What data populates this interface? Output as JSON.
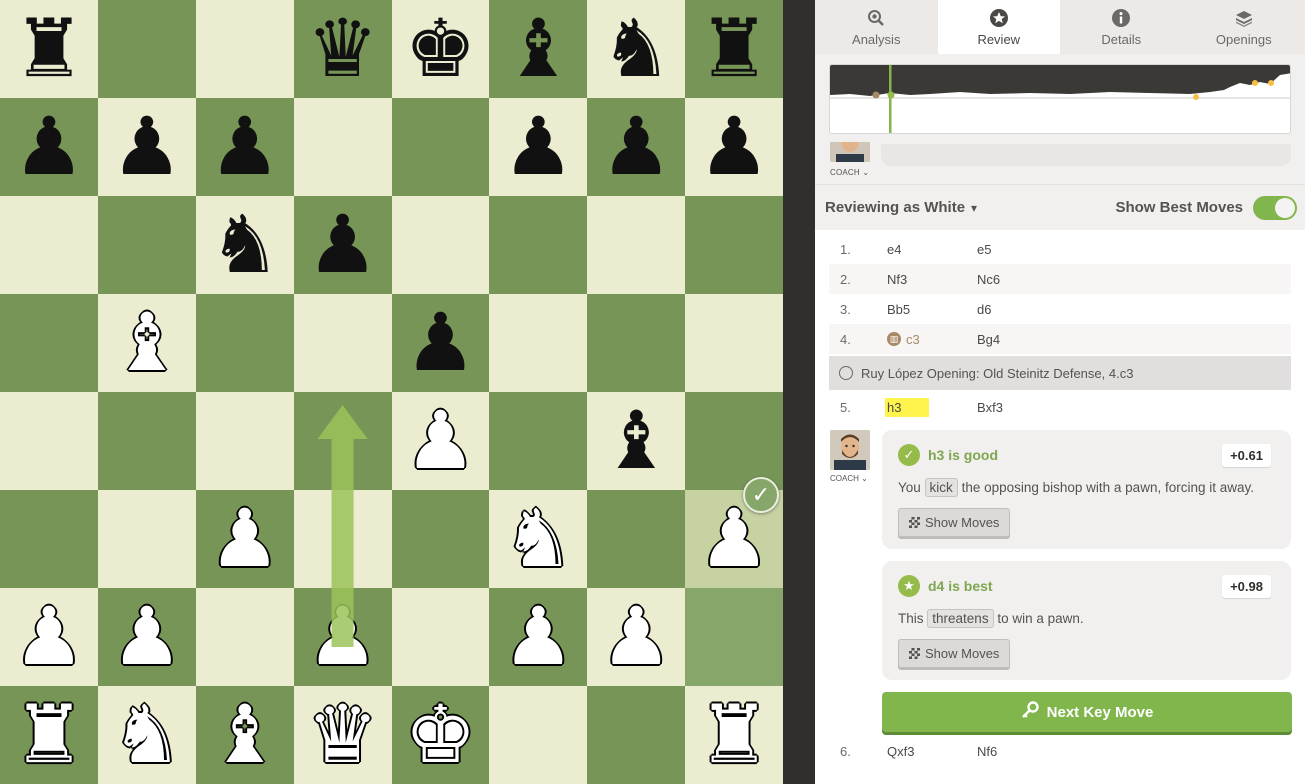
{
  "board": {
    "pieces": [
      [
        "r",
        "",
        "",
        "q",
        "k",
        "b",
        "n",
        "r"
      ],
      [
        "p",
        "p",
        "p",
        "",
        "",
        "p",
        "p",
        "p"
      ],
      [
        "",
        "",
        "n",
        "p",
        "",
        "",
        "",
        ""
      ],
      [
        "",
        "B",
        "",
        "",
        "p",
        "",
        "",
        ""
      ],
      [
        "",
        "",
        "",
        "",
        "P",
        "",
        "b",
        ""
      ],
      [
        "",
        "",
        "P",
        "",
        "",
        "N",
        "",
        "P"
      ],
      [
        "P",
        "P",
        "",
        "P",
        "",
        "P",
        "P",
        ""
      ],
      [
        "R",
        "N",
        "B",
        "Q",
        "K",
        "",
        "",
        "R"
      ]
    ],
    "highlighted_squares": [
      "h3",
      "h2"
    ],
    "best_move_arrow": {
      "from": "d2",
      "to": "d4",
      "color": "#9bc35a"
    },
    "badge_icon": "check-icon",
    "badge_square": "h3"
  },
  "tabs": [
    {
      "label": "Analysis",
      "icon": "magnifier-icon",
      "active": false
    },
    {
      "label": "Review",
      "icon": "star-icon",
      "active": true
    },
    {
      "label": "Details",
      "icon": "info-icon",
      "active": false
    },
    {
      "label": "Openings",
      "icon": "book-stack-icon",
      "active": false
    }
  ],
  "coach_label": "COACH",
  "review": {
    "reviewing_as": "Reviewing as White",
    "show_best_label": "Show Best Moves",
    "show_best_on": true
  },
  "moves": [
    {
      "num": "1.",
      "white": "e4",
      "black": "e5"
    },
    {
      "num": "2.",
      "white": "Nf3",
      "black": "Nc6"
    },
    {
      "num": "3.",
      "white": "Bb5",
      "black": "d6"
    },
    {
      "num": "4.",
      "white": "c3",
      "black": "Bg4",
      "book": true
    }
  ],
  "opening_name": "Ruy López Opening: Old Steinitz Defense, 4.c3",
  "move5": {
    "num": "5.",
    "white": "h3",
    "black": "Bxf3"
  },
  "feedback": [
    {
      "icon": "check-icon",
      "title": "h3 is good",
      "eval": "+0.61",
      "text_before": "You",
      "keyword": "kick",
      "text_after": "the opposing bishop with a pawn, forcing it away.",
      "button": "Show Moves"
    },
    {
      "icon": "star-icon",
      "title": "d4 is best",
      "eval": "+0.98",
      "text_before": "This",
      "keyword": "threatens",
      "text_after": "to win a pawn.",
      "button": "Show Moves"
    }
  ],
  "next_key_move": "Next Key Move",
  "move6": {
    "num": "6.",
    "white": "Qxf3",
    "black": "Nf6"
  },
  "colors": {
    "accent_green": "#81b64c",
    "light_square": "#ebecd0",
    "dark_square": "#779556",
    "move_highlight": "#fff34d"
  }
}
